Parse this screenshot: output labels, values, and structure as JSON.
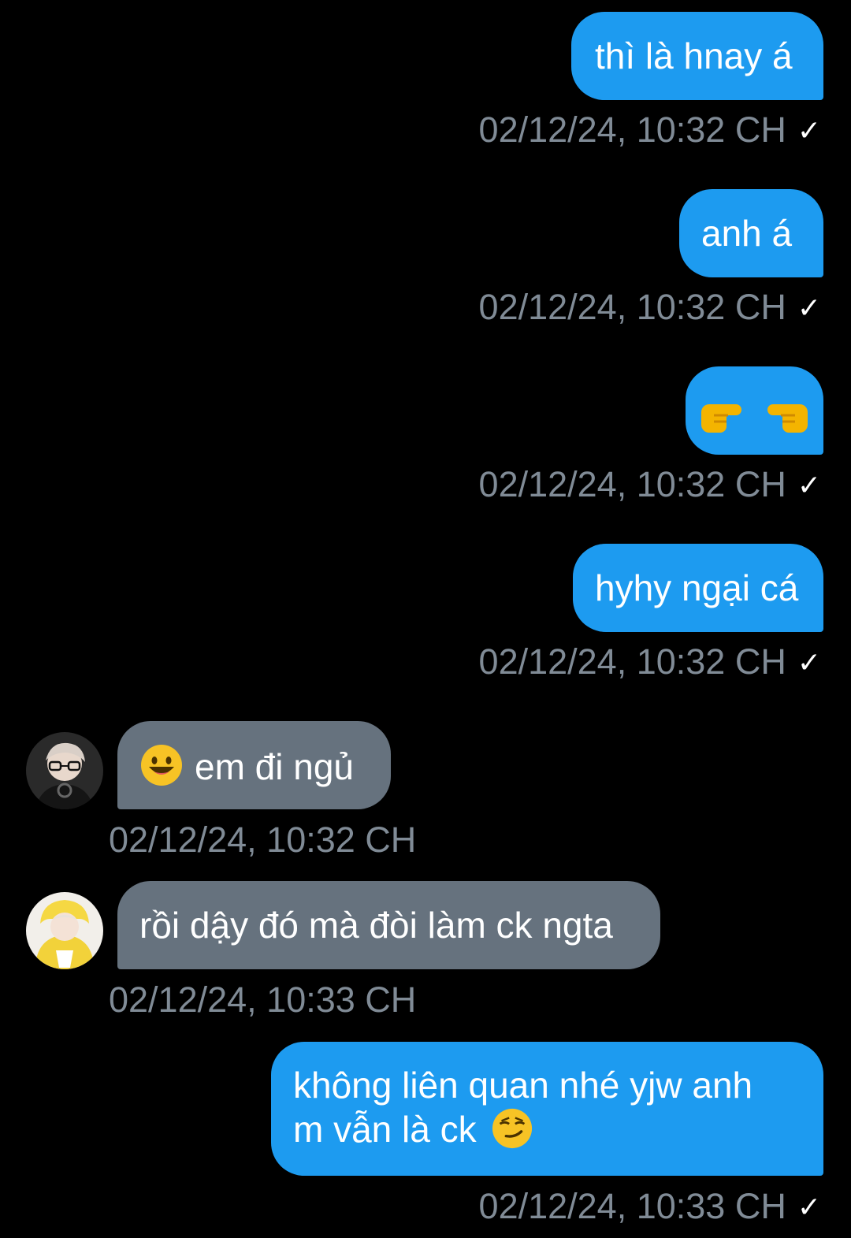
{
  "colors": {
    "background": "#000000",
    "outgoing_bubble": "#1d9bf0",
    "incoming_bubble": "#66727e",
    "timestamp": "#808b96"
  },
  "messages": [
    {
      "direction": "outgoing",
      "text": "thì là hnay á",
      "timestamp": "02/12/24, 10:32 CH",
      "status_icon": "single-check-icon"
    },
    {
      "direction": "outgoing",
      "text": "anh á",
      "timestamp": "02/12/24, 10:32 CH",
      "status_icon": "single-check-icon"
    },
    {
      "direction": "outgoing",
      "text": "",
      "emoji": "pointing-fingers-emoji",
      "timestamp": "02/12/24, 10:32 CH",
      "status_icon": "single-check-icon"
    },
    {
      "direction": "outgoing",
      "text": "hyhy ngại cá",
      "timestamp": "02/12/24, 10:32 CH",
      "status_icon": "single-check-icon"
    },
    {
      "direction": "incoming",
      "avatar_icon": "avatar-boy-glasses",
      "emoji": "grinning-face-emoji",
      "text": "em đi ngủ",
      "timestamp": "02/12/24, 10:32 CH"
    },
    {
      "direction": "incoming",
      "avatar_icon": "avatar-yellow-hood",
      "text": "rồi dậy đó mà đòi làm ck ngta",
      "timestamp": "02/12/24, 10:33 CH"
    },
    {
      "direction": "outgoing",
      "text_line1": "không liên quan nhé yjw anh",
      "text_line2": "m vẫn là ck",
      "emoji": "smirking-face-emoji",
      "timestamp": "02/12/24, 10:33 CH",
      "status_icon": "single-check-icon"
    }
  ]
}
